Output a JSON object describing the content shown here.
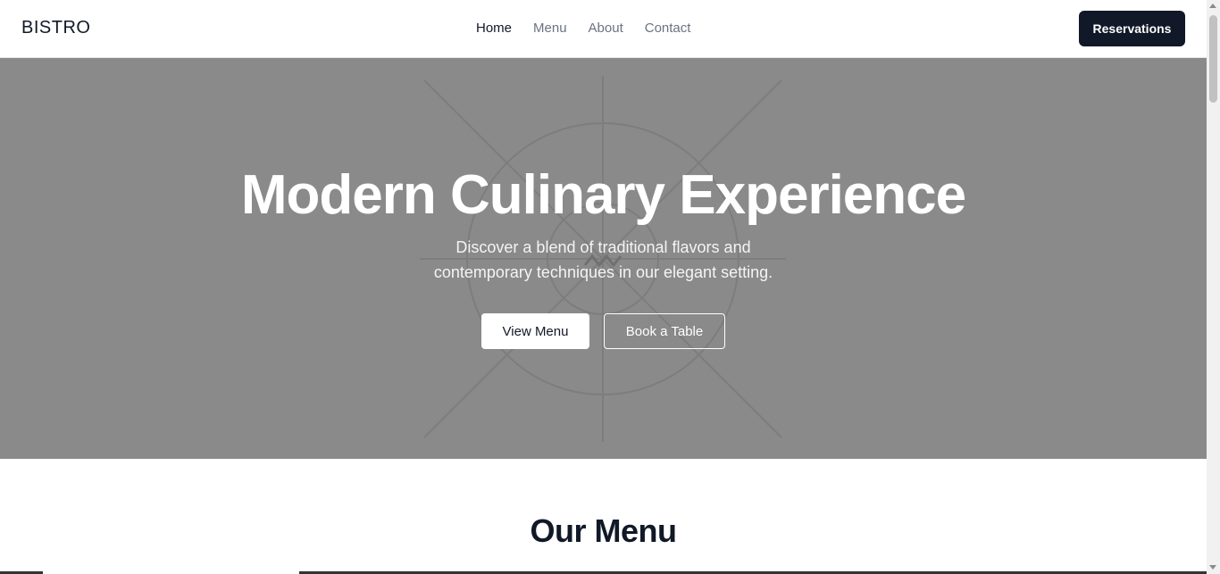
{
  "header": {
    "logo": "BISTRO",
    "nav": [
      {
        "label": "Home",
        "active": true
      },
      {
        "label": "Menu",
        "active": false
      },
      {
        "label": "About",
        "active": false
      },
      {
        "label": "Contact",
        "active": false
      }
    ],
    "cta_label": "Reservations"
  },
  "hero": {
    "title": "Modern Culinary Experience",
    "subtitle_line1": "Discover a blend of traditional flavors and",
    "subtitle_line2": "contemporary techniques in our elegant setting.",
    "primary_button": "View Menu",
    "secondary_button": "Book a Table",
    "background_color": "#8a8a8a"
  },
  "menu_section": {
    "title": "Our Menu"
  },
  "colors": {
    "dark": "#111827",
    "muted_nav": "#6b7280",
    "hero_bg": "#8a8a8a"
  }
}
